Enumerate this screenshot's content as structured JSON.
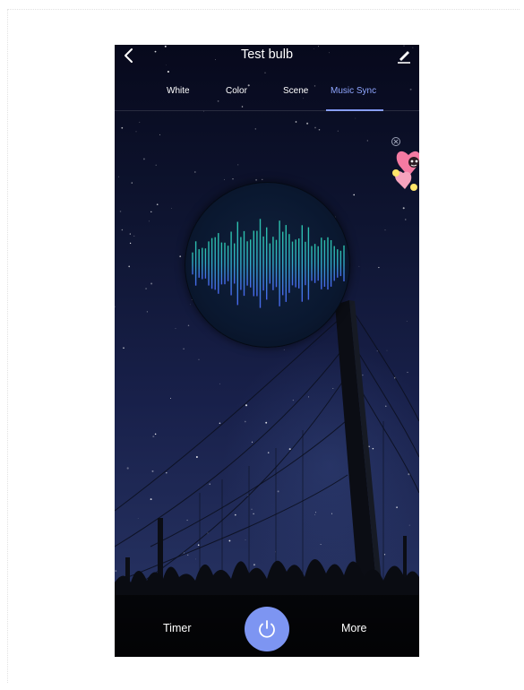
{
  "header": {
    "title": "Test bulb",
    "back_icon": "chevron-left-icon",
    "edit_icon": "pencil-icon"
  },
  "tabs": [
    {
      "label": "White",
      "active": false
    },
    {
      "label": "Color",
      "active": false
    },
    {
      "label": "Scene",
      "active": false
    },
    {
      "label": "Music Sync",
      "active": true
    }
  ],
  "mascot": {
    "icon": "heart-mascot-icon",
    "close_icon": "close-circle-icon"
  },
  "visualizer": {
    "icon": "sound-wave-icon"
  },
  "bottom_bar": {
    "timer_label": "Timer",
    "more_label": "More",
    "power_icon": "power-icon"
  },
  "colors": {
    "accent": "#7d95f2",
    "active_tab": "#8fa6ff",
    "wave_top": "#2fd3b8",
    "wave_bottom": "#4d6cff"
  }
}
